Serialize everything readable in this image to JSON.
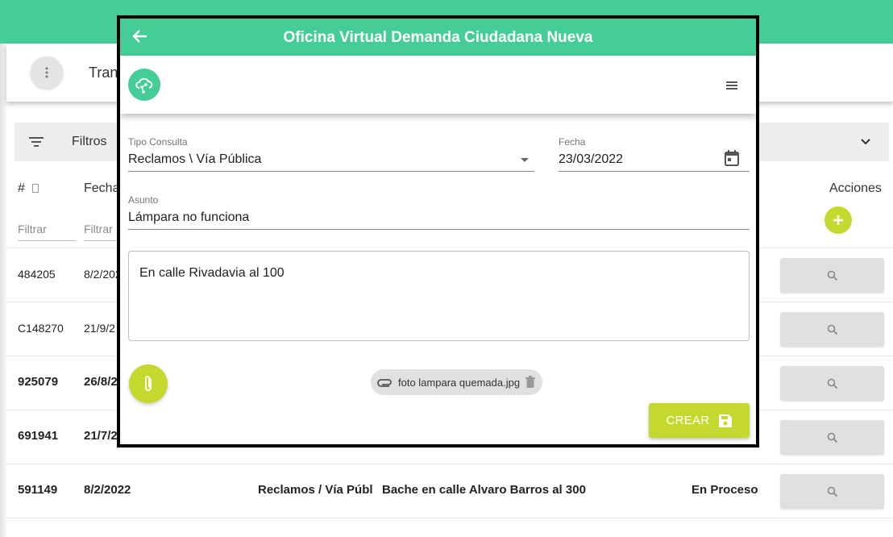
{
  "background": {
    "header_title": "Tran",
    "filters_label": "Filtros",
    "columns": {
      "id": "#",
      "date": "Fecha",
      "actions": "Acciones"
    },
    "filter_placeholder": "Filtrar",
    "rows": [
      {
        "id": "484205",
        "date": "8/2/202",
        "type": "",
        "subject": "",
        "status": "",
        "bold": false
      },
      {
        "id": "C148270",
        "date": "21/9/2",
        "type": "",
        "subject": "",
        "status": "",
        "bold": false
      },
      {
        "id": "925079",
        "date": "26/8/2",
        "type": "",
        "subject": "",
        "status": "",
        "bold": true
      },
      {
        "id": "691941",
        "date": "21/7/2",
        "type": "",
        "subject": "",
        "status": "",
        "bold": true
      },
      {
        "id": "591149",
        "date": "8/2/2022",
        "type": "Reclamos / Vía Públ",
        "subject": "Bache en calle Alvaro Barros al 300",
        "status": "En Proceso",
        "bold": true
      }
    ]
  },
  "dialog": {
    "title": "Oficina Virtual Demanda Ciudadana Nueva",
    "tipo_label": "Tipo Consulta",
    "tipo_value": "Reclamos \\ Vía Pública",
    "fecha_label": "Fecha",
    "fecha_value": "23/03/2022",
    "asunto_label": "Asunto",
    "asunto_value": "Lámpara no funciona",
    "description": "En calle Rivadavia al 100",
    "attachment": "foto lampara quemada.jpg",
    "crear_label": "CREAR"
  },
  "colors": {
    "green": "#45cd97",
    "lime": "#c4d82e"
  }
}
